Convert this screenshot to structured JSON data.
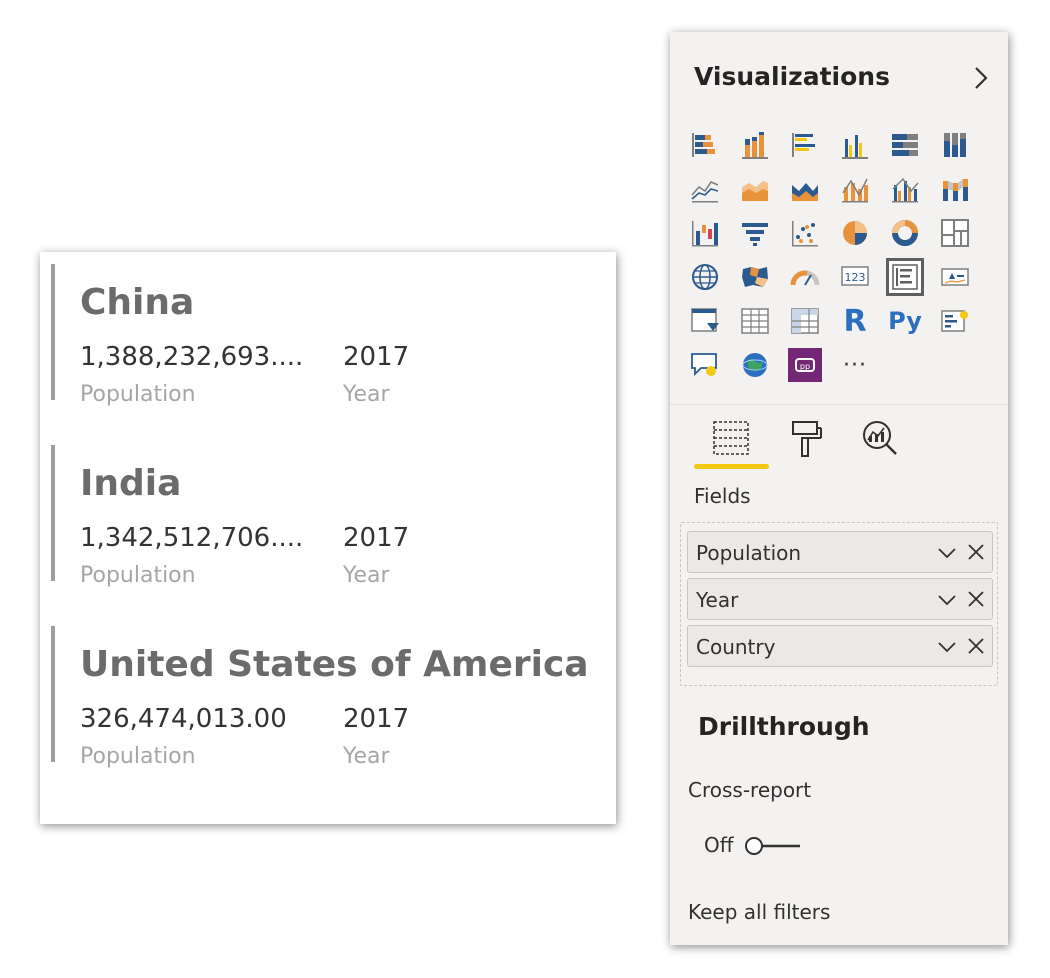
{
  "cards": [
    {
      "title": "China",
      "values": [
        {
          "value": "1,388,232,693....",
          "label": "Population"
        },
        {
          "value": "2017",
          "label": "Year"
        }
      ]
    },
    {
      "title": "India",
      "values": [
        {
          "value": "1,342,512,706....",
          "label": "Population"
        },
        {
          "value": "2017",
          "label": "Year"
        }
      ]
    },
    {
      "title": "United States of America",
      "values": [
        {
          "value": "326,474,013.00",
          "label": "Population"
        },
        {
          "value": "2017",
          "label": "Year"
        }
      ]
    }
  ],
  "pane": {
    "title": "Visualizations",
    "collapse_icon": "chevron-right-icon",
    "visual_icons": [
      "stacked-bar-chart-icon",
      "stacked-column-chart-icon",
      "clustered-bar-chart-icon",
      "clustered-column-chart-icon",
      "100-stacked-bar-chart-icon",
      "100-stacked-column-chart-icon",
      "line-chart-icon",
      "area-chart-icon",
      "stacked-area-chart-icon",
      "line-and-stacked-column-chart-icon",
      "line-and-clustered-column-chart-icon",
      "ribbon-chart-icon",
      "waterfall-chart-icon",
      "funnel-icon",
      "scatter-chart-icon",
      "pie-chart-icon",
      "donut-chart-icon",
      "treemap-icon",
      "map-icon",
      "filled-map-icon",
      "gauge-icon",
      "card-icon",
      "multi-row-card-icon",
      "kpi-icon",
      "slicer-icon",
      "table-icon",
      "matrix-icon",
      "r-visual-icon",
      "python-visual-icon",
      "key-influencers-icon",
      "qa-icon",
      "arcgis-map-icon",
      "power-apps-icon",
      "more-visuals-icon"
    ],
    "r_glyph": "R",
    "py_glyph": "Py",
    "more_glyph": "···",
    "selected_visual": "multi-row-card",
    "tabs": [
      "fields-tab",
      "format-tab",
      "analytics-tab"
    ],
    "active_tab": "fields-tab",
    "fields_label": "Fields",
    "fields": [
      {
        "name": "Population"
      },
      {
        "name": "Year"
      },
      {
        "name": "Country"
      }
    ],
    "drillthrough": {
      "title": "Drillthrough",
      "cross_report_label": "Cross-report",
      "toggle_state": "Off",
      "keep_filters_label": "Keep all filters"
    }
  },
  "colors": {
    "accent_yellow": "#f2c811",
    "bar_orange": "#e8923b",
    "bar_blue": "#2c5a8f",
    "power_apps_purple": "#742774",
    "card_accent_bar": "#9e9e9e"
  }
}
